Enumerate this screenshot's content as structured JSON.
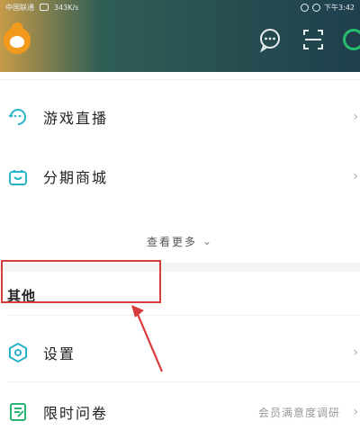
{
  "status_bar": {
    "carrier": "中国联通",
    "speed": "343K/s",
    "time": "下午3:42"
  },
  "header": {
    "logo_icon": "orange-mascot-icon",
    "chat_icon": "chat-bubble-icon",
    "scan_icon": "scan-icon",
    "ring_icon": "green-ring-icon",
    "accent_color": "#25c06d"
  },
  "list": {
    "items": [
      {
        "label": "游戏直播",
        "icon": "game-live-icon"
      },
      {
        "label": "分期商城",
        "icon": "shopping-bag-icon"
      }
    ],
    "more_label": "查看更多"
  },
  "other_section": {
    "title": "其他",
    "items": [
      {
        "label": "设置",
        "icon": "settings-hexagon-icon"
      },
      {
        "label": "限时问卷",
        "icon": "survey-icon",
        "hint": "会员满意度调研"
      }
    ]
  },
  "annotation": {
    "color": "#d93a3a"
  }
}
